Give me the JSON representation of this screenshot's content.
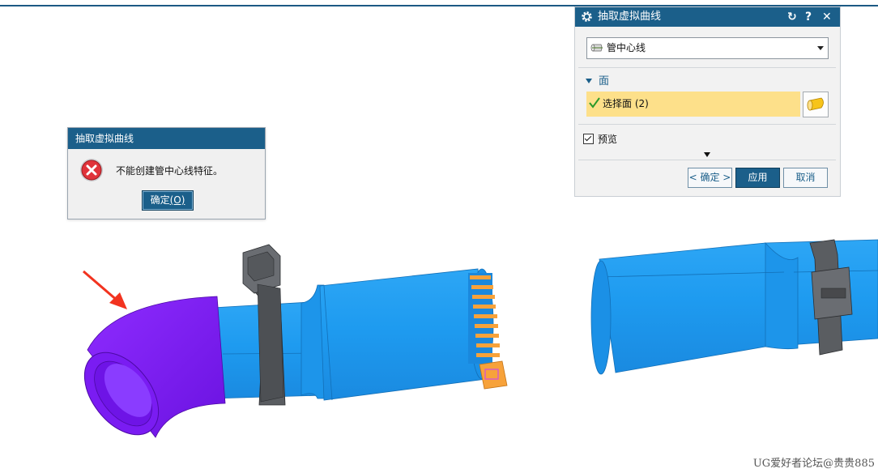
{
  "error_dialog": {
    "title": "抽取虚拟曲线",
    "message": "不能创建管中心线特征。",
    "ok_label": "确定",
    "ok_shortcut": "(O)"
  },
  "panel": {
    "title": "抽取虚拟曲线",
    "reset_glyph": "↻",
    "help_glyph": "?",
    "close_glyph": "✕",
    "type_value": "管中心线",
    "group_label": "面",
    "select_face_label": "选择面 (2)",
    "preview_label": "预览",
    "preview_checked": true,
    "ok_label": "< 确定 >",
    "apply_label": "应用",
    "cancel_label": "取消"
  },
  "watermark": "UG爱好者论坛@贵贵885",
  "colors": {
    "accent": "#1b5f8a",
    "pipe": "#1e9bf0",
    "elbow": "#7a1cf2",
    "clamp": "#5a5d61",
    "tape": "#f7a23a",
    "highlight": "#fde08a",
    "arrow": "#f2331f"
  }
}
